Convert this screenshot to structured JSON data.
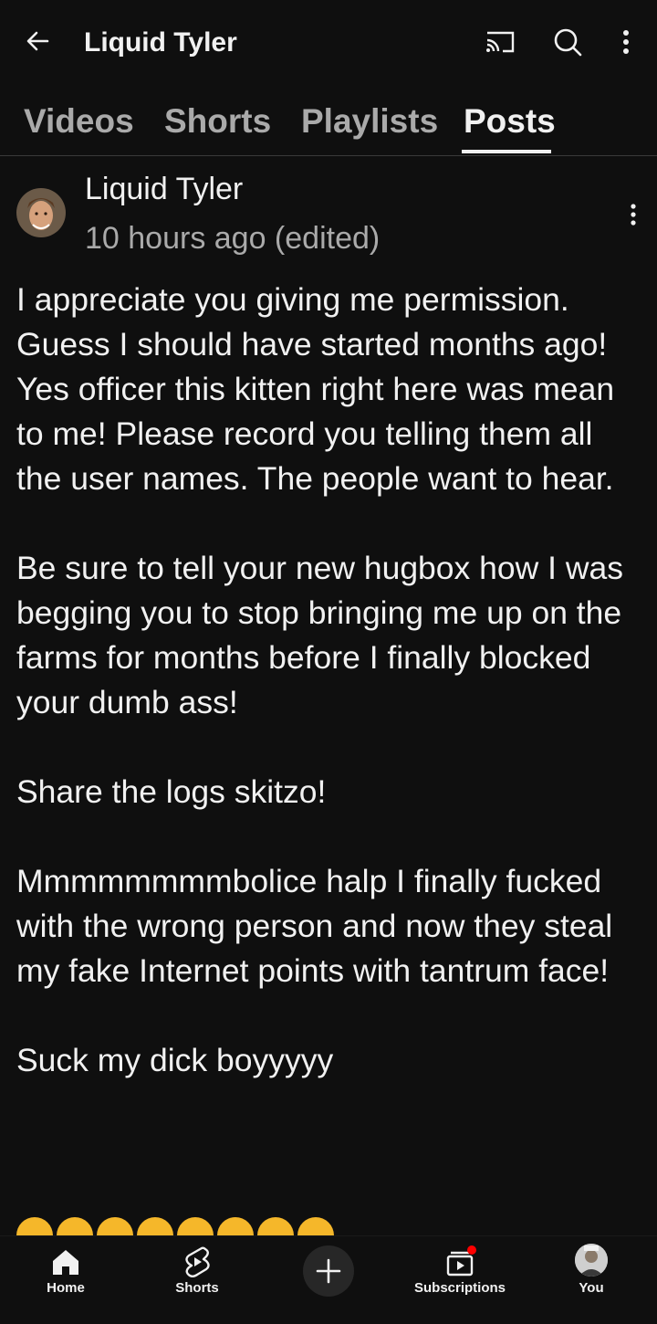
{
  "header": {
    "title": "Liquid Tyler",
    "back_icon": "arrow-left-icon",
    "cast_icon": "cast-icon",
    "search_icon": "search-icon",
    "more_icon": "more-vertical-icon"
  },
  "tabs": [
    {
      "label": "Videos",
      "active": false
    },
    {
      "label": "Shorts",
      "active": false
    },
    {
      "label": "Playlists",
      "active": false
    },
    {
      "label": "Posts",
      "active": true
    }
  ],
  "post": {
    "author": "Liquid Tyler",
    "time": "10 hours ago (edited)",
    "paragraphs": [
      "I appreciate you giving me permission. Guess I should have started months ago!  Yes officer this kitten right here was mean to me!  Please record you telling them all the user names.  The people want to hear.",
      "Be sure to tell your new hugbox how I was begging you to stop bringing me up on the farms for months before I finally blocked your dumb ass!",
      "Share the logs skitzo!",
      "Mmmmmmmmbolice halp I finally fucked with the wrong person and now they steal my fake Internet points with tantrum face!",
      "Suck my dick boyyyyy"
    ],
    "emoji_icon": "rolling-laughing-emoji",
    "emoji_count": 8
  },
  "bottom_nav": {
    "home_label": "Home",
    "shorts_label": "Shorts",
    "create_icon": "plus-icon",
    "subscriptions_label": "Subscriptions",
    "you_label": "You"
  },
  "colors": {
    "background": "#0f0f0f",
    "text_primary": "#f1f1f1",
    "text_secondary": "#aaaaaa",
    "notification_dot": "#ff0000"
  }
}
